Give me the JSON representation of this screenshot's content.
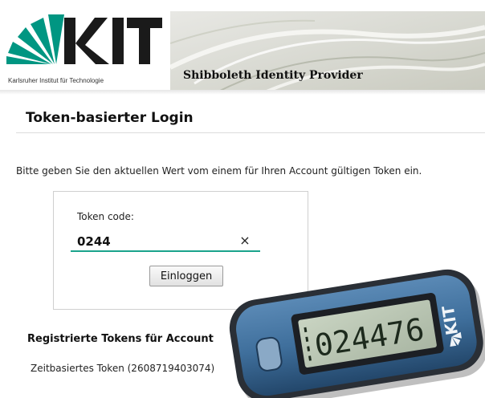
{
  "header": {
    "logo_text": "KIT",
    "logo_subtitle": "Karlsruher Institut für Technologie",
    "idp_title": "Shibboleth Identity Provider"
  },
  "main": {
    "title": "Token-basierter Login",
    "instruction": "Bitte geben Sie den aktuellen Wert vom einem für Ihren Account gültigen Token ein.",
    "form": {
      "token_label": "Token code:",
      "token_value": "0244",
      "clear_glyph": "×",
      "login_label": "Einloggen"
    },
    "registered": {
      "heading": "Registrierte Tokens für Account",
      "items": [
        "Zeitbasiertes Token (2608719403074)"
      ]
    }
  },
  "device": {
    "display_value": "024476",
    "brand_text": "KIT"
  },
  "colors": {
    "kit_green": "#009682",
    "input_underline": "#1aa38c",
    "device_body": "#3f6f9c"
  },
  "icons": {
    "clear": "close-icon",
    "logo": "kit-logo-icon"
  }
}
